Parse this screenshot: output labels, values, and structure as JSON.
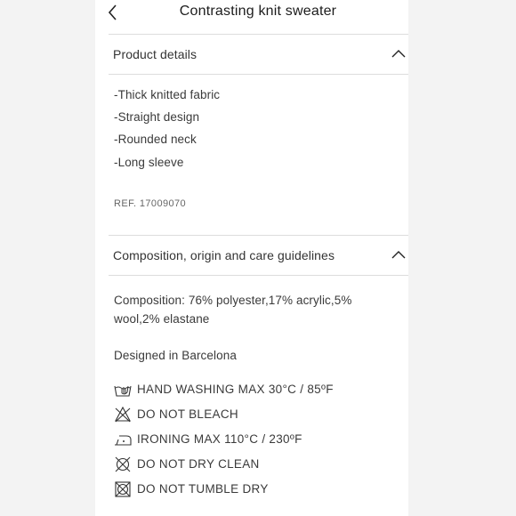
{
  "header": {
    "title": "Contrasting knit sweater"
  },
  "product_details": {
    "label": "Product details",
    "lines": [
      "-Thick knitted fabric",
      "-Straight design",
      "-Rounded neck",
      "-Long sleeve"
    ],
    "ref": "REF. 17009070"
  },
  "composition": {
    "label": "Composition, origin and care guidelines",
    "composition_text": "Composition: 76%  polyester,17%  acrylic,5% wool,2%  elastane",
    "origin_text": "Designed in Barcelona",
    "care": [
      {
        "icon": "hand-wash-icon",
        "text": "HAND WASHING MAX 30°C / 85ºF"
      },
      {
        "icon": "no-bleach-icon",
        "text": "DO NOT BLEACH"
      },
      {
        "icon": "iron-icon",
        "text": "IRONING MAX 110°C / 230ºF"
      },
      {
        "icon": "no-dry-clean-icon",
        "text": "DO NOT DRY CLEAN"
      },
      {
        "icon": "no-tumble-dry-icon",
        "text": "DO NOT TUMBLE DRY"
      }
    ]
  }
}
